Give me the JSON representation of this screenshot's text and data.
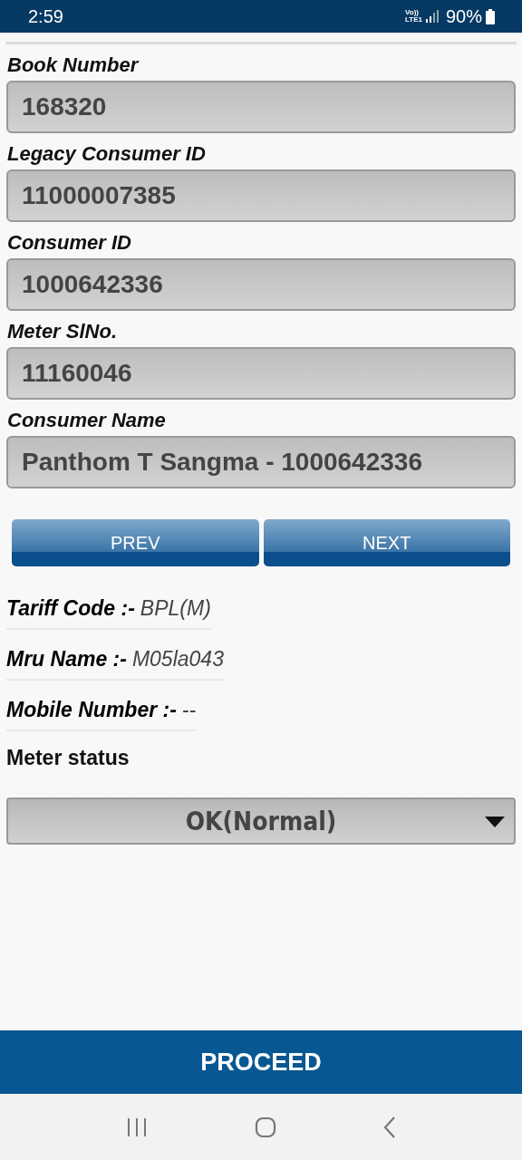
{
  "status_bar": {
    "time": "2:59",
    "volte": "Vo))",
    "network": "LTE1",
    "battery": "90%"
  },
  "fields": [
    {
      "label": "Book Number",
      "value": "168320"
    },
    {
      "label": "Legacy Consumer ID",
      "value": "11000007385"
    },
    {
      "label": "Consumer ID",
      "value": "1000642336"
    },
    {
      "label": "Meter SlNo.",
      "value": "11160046"
    },
    {
      "label": "Consumer Name",
      "value": "Panthom T Sangma - 1000642336"
    }
  ],
  "buttons": [
    "PREV",
    "NEXT"
  ],
  "info": [
    {
      "label": "Tariff Code :-",
      "value": "BPL(M)"
    },
    {
      "label": "Mru Name :-",
      "value": "M05la043"
    },
    {
      "label": "Mobile Number :-",
      "value": "--"
    }
  ],
  "meter_status": {
    "label": "Meter status",
    "value": "OK(Normal)"
  },
  "proceed": "PROCEED"
}
